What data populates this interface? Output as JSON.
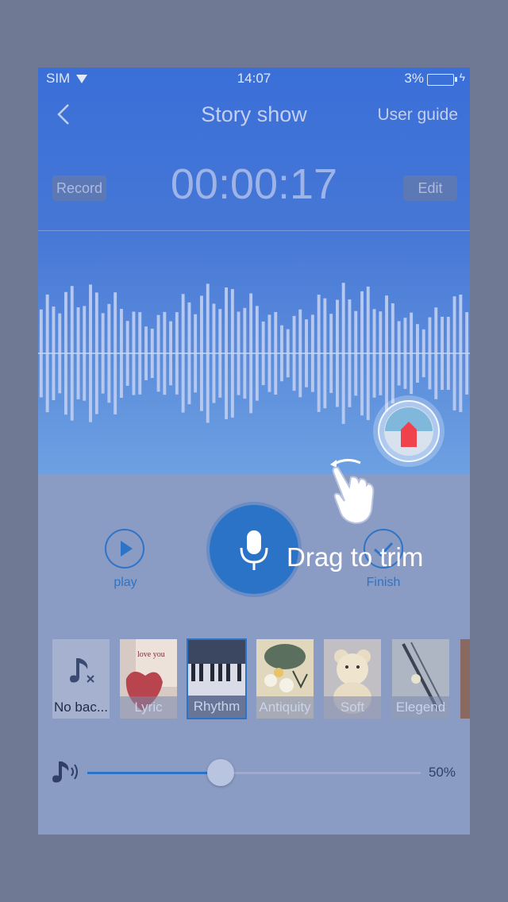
{
  "status": {
    "carrier": "SIM",
    "time": "14:07",
    "battery": "3%"
  },
  "header": {
    "title": "Story show",
    "guide": "User guide"
  },
  "recorder": {
    "record_label": "Record",
    "edit_label": "Edit",
    "timer": "00:00:17"
  },
  "controls": {
    "play_label": "play",
    "finish_label": "Finish",
    "hint": "Drag to trim"
  },
  "music": {
    "items": [
      {
        "label": "No bac...",
        "icon": "music-note-off-icon"
      },
      {
        "label": "Lyric",
        "icon": "photo-love-heart"
      },
      {
        "label": "Rhythm",
        "icon": "photo-piano-keys",
        "selected": true
      },
      {
        "label": "Antiquity",
        "icon": "photo-lotus-painting"
      },
      {
        "label": "Soft",
        "icon": "photo-teddy-bear"
      },
      {
        "label": "Elegend",
        "icon": "photo-flute"
      }
    ]
  },
  "volume": {
    "label": "50%",
    "level": 0.4
  },
  "colors": {
    "accent": "#2b73c6",
    "header": "#3a6fd8",
    "trim_marker": "#f0424d"
  }
}
